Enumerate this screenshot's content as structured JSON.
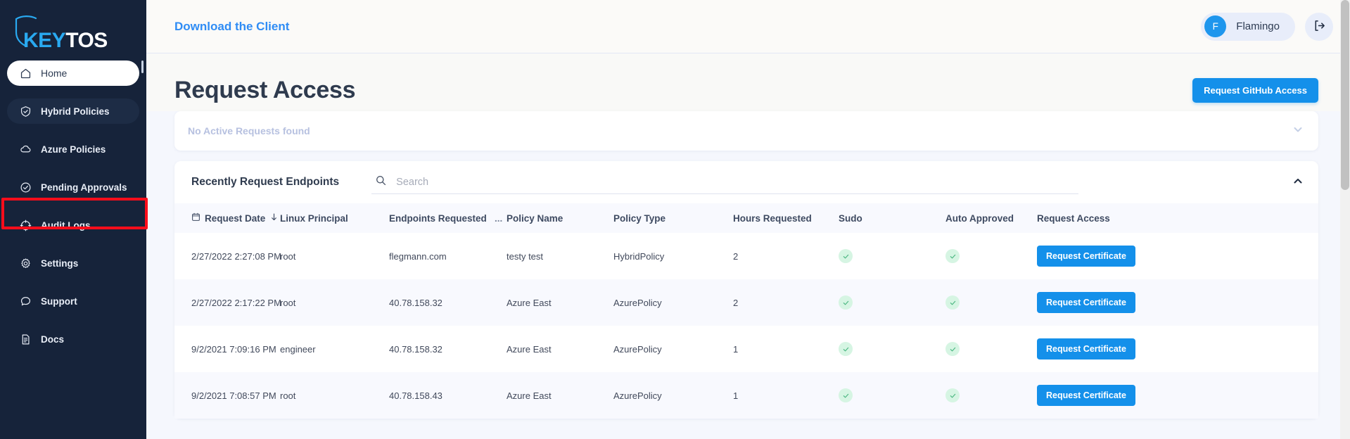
{
  "brand": {
    "logo_key": "KEY",
    "logo_tos": "TOS",
    "accent_blue": "#29a9f0",
    "sidebar_bg": "#16233a",
    "primary_button": "#1490ea",
    "highlight_box_color": "#fc0d1b"
  },
  "sidebar": {
    "items": [
      {
        "label": "Home",
        "icon": "home-icon",
        "state": "active"
      },
      {
        "label": "Hybrid Policies",
        "icon": "shield-icon",
        "state": "hover"
      },
      {
        "label": "Azure Policies",
        "icon": "cloud-icon",
        "state": "normal"
      },
      {
        "label": "Pending Approvals",
        "icon": "check-circle-icon",
        "state": "normal"
      },
      {
        "label": "Audit Logs",
        "icon": "target-icon",
        "state": "normal"
      },
      {
        "label": "Settings",
        "icon": "gear-icon",
        "state": "highlighted"
      },
      {
        "label": "Support",
        "icon": "chat-icon",
        "state": "normal"
      },
      {
        "label": "Docs",
        "icon": "document-icon",
        "state": "normal"
      }
    ]
  },
  "topbar": {
    "download_link": "Download the Client",
    "user_initial": "F",
    "user_name": "Flamingo",
    "logout_icon": "logout-icon"
  },
  "page": {
    "title": "Request Access",
    "github_button": "Request GitHub Access"
  },
  "active_requests_panel": {
    "empty_message": "No Active Requests found",
    "collapse_icon": "chevron-down-icon"
  },
  "recent_panel": {
    "title": "Recently Request Endpoints",
    "search_placeholder": "Search",
    "search_value": "",
    "search_icon": "search-icon",
    "collapse_icon": "chevron-up-icon",
    "columns": [
      {
        "label": "Request Date",
        "icon": "calendar-icon",
        "sort": "descending"
      },
      {
        "label": "Linux Principal"
      },
      {
        "label": "Endpoints Requested"
      },
      {
        "label": "..."
      },
      {
        "label": "Policy Name"
      },
      {
        "label": "Policy Type"
      },
      {
        "label": "Hours Requested"
      },
      {
        "label": "Sudo"
      },
      {
        "label": "Auto Approved"
      },
      {
        "label": "Request Access"
      }
    ],
    "rows": [
      {
        "request_date": "2/27/2022 2:27:08 PM",
        "linux_principal": "root",
        "endpoints_requested": "flegmann.com",
        "policy_name": "testy test",
        "policy_type": "HybridPolicy",
        "hours_requested": "2",
        "sudo": true,
        "auto_approved": true,
        "action_label": "Request Certificate"
      },
      {
        "request_date": "2/27/2022 2:17:22 PM",
        "linux_principal": "root",
        "endpoints_requested": "40.78.158.32",
        "policy_name": "Azure East",
        "policy_type": "AzurePolicy",
        "hours_requested": "2",
        "sudo": true,
        "auto_approved": true,
        "action_label": "Request Certificate"
      },
      {
        "request_date": "9/2/2021 7:09:16 PM",
        "linux_principal": "engineer",
        "endpoints_requested": "40.78.158.32",
        "policy_name": "Azure East",
        "policy_type": "AzurePolicy",
        "hours_requested": "1",
        "sudo": true,
        "auto_approved": true,
        "action_label": "Request Certificate"
      },
      {
        "request_date": "9/2/2021 7:08:57 PM",
        "linux_principal": "root",
        "endpoints_requested": "40.78.158.43",
        "policy_name": "Azure East",
        "policy_type": "AzurePolicy",
        "hours_requested": "1",
        "sudo": true,
        "auto_approved": true,
        "action_label": "Request Certificate"
      }
    ]
  }
}
